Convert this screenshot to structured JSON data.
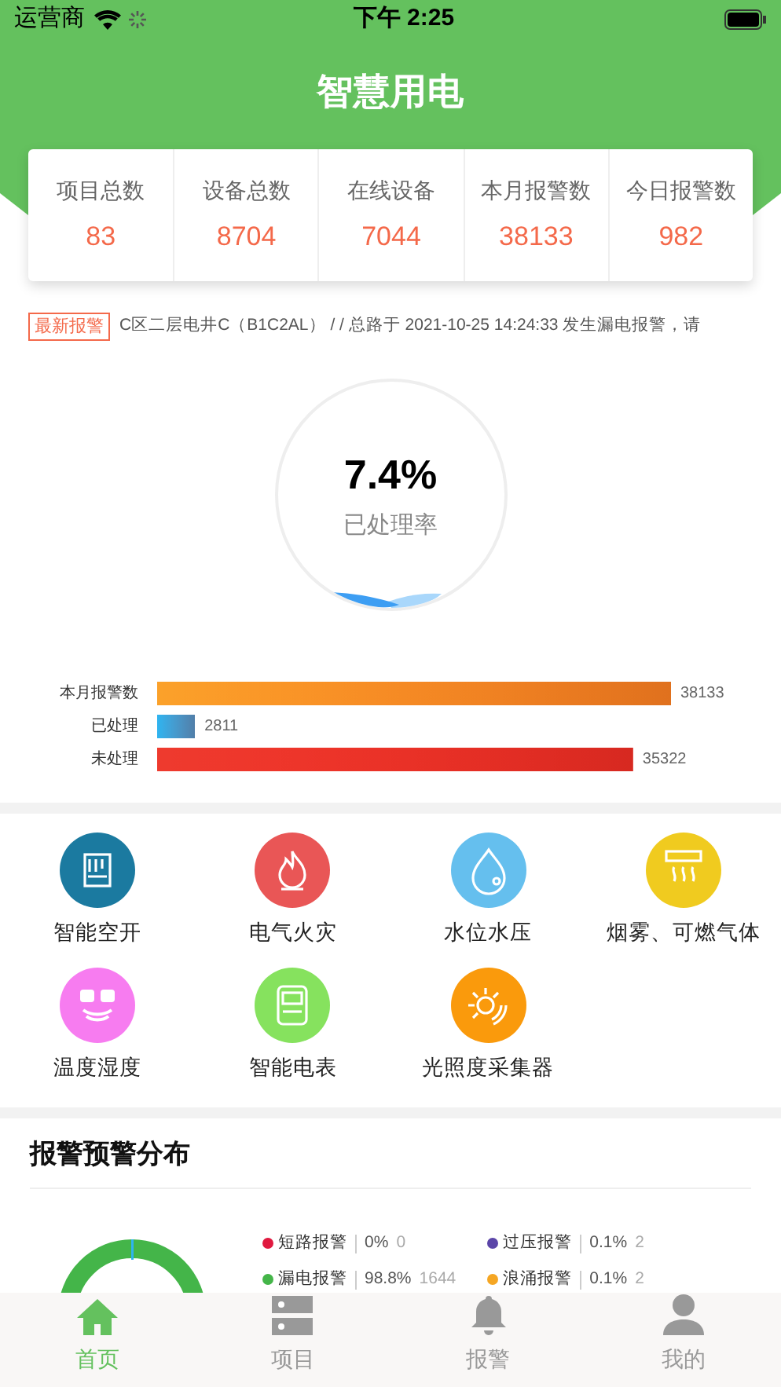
{
  "status_bar": {
    "carrier": "运营商",
    "time": "下午 2:25"
  },
  "header": {
    "title": "智慧用电"
  },
  "stats": [
    {
      "label": "项目总数",
      "value": "83"
    },
    {
      "label": "设备总数",
      "value": "8704"
    },
    {
      "label": "在线设备",
      "value": "7044"
    },
    {
      "label": "本月报警数",
      "value": "38133"
    },
    {
      "label": "今日报警数",
      "value": "982"
    }
  ],
  "latest_alarm": {
    "badge": "最新报警",
    "text": "C区二层电井C（B1C2AL） / / 总路于 2021-10-25 14:24:33 发生漏电报警，请"
  },
  "gauge": {
    "value": "7.4%",
    "label": "已处理率"
  },
  "bar_chart": {
    "chart_data": {
      "type": "bar",
      "orientation": "horizontal",
      "categories": [
        "本月报警数",
        "已处理",
        "未处理"
      ],
      "colors": [
        "#fba12a",
        "#2eb4f0",
        "#ee3a2e"
      ],
      "values": [
        38133,
        2811,
        35322
      ],
      "value_labels": [
        "38133",
        "2811",
        "35322"
      ],
      "data_labels": true
    }
  },
  "categories": [
    {
      "kind": "breaker",
      "label": "智能空开",
      "color": "#1b7aa0"
    },
    {
      "kind": "fire",
      "label": "电气火灾",
      "color": "#e95656"
    },
    {
      "kind": "water",
      "label": "水位水压",
      "color": "#65bfee"
    },
    {
      "kind": "smoke",
      "label": "烟雾、可燃气体",
      "color": "#f0cb1f"
    },
    {
      "kind": "climate",
      "label": "温度湿度",
      "color": "#f77cf0"
    },
    {
      "kind": "meter",
      "label": "智能电表",
      "color": "#86e25e"
    },
    {
      "kind": "light",
      "label": "光照度采集器",
      "color": "#fa9a0c"
    }
  ],
  "distribution": {
    "title": "报警预警分布",
    "legend": [
      {
        "label": "短路报警",
        "percent": "0%",
        "count": "0",
        "color": "#e0193f"
      },
      {
        "label": "过压报警",
        "percent": "0.1%",
        "count": "2",
        "color": "#5b45a8"
      },
      {
        "label": "漏电报警",
        "percent": "98.8%",
        "count": "1644",
        "color": "#44b549"
      },
      {
        "label": "浪涌报警",
        "percent": "0.1%",
        "count": "2",
        "color": "#f5a623"
      }
    ]
  },
  "tabs": [
    {
      "kind": "home",
      "label": "首页",
      "selected": true
    },
    {
      "kind": "projects",
      "label": "项目",
      "selected": false
    },
    {
      "kind": "alarms",
      "label": "报警",
      "selected": false
    },
    {
      "kind": "mine",
      "label": "我的",
      "selected": false
    }
  ]
}
